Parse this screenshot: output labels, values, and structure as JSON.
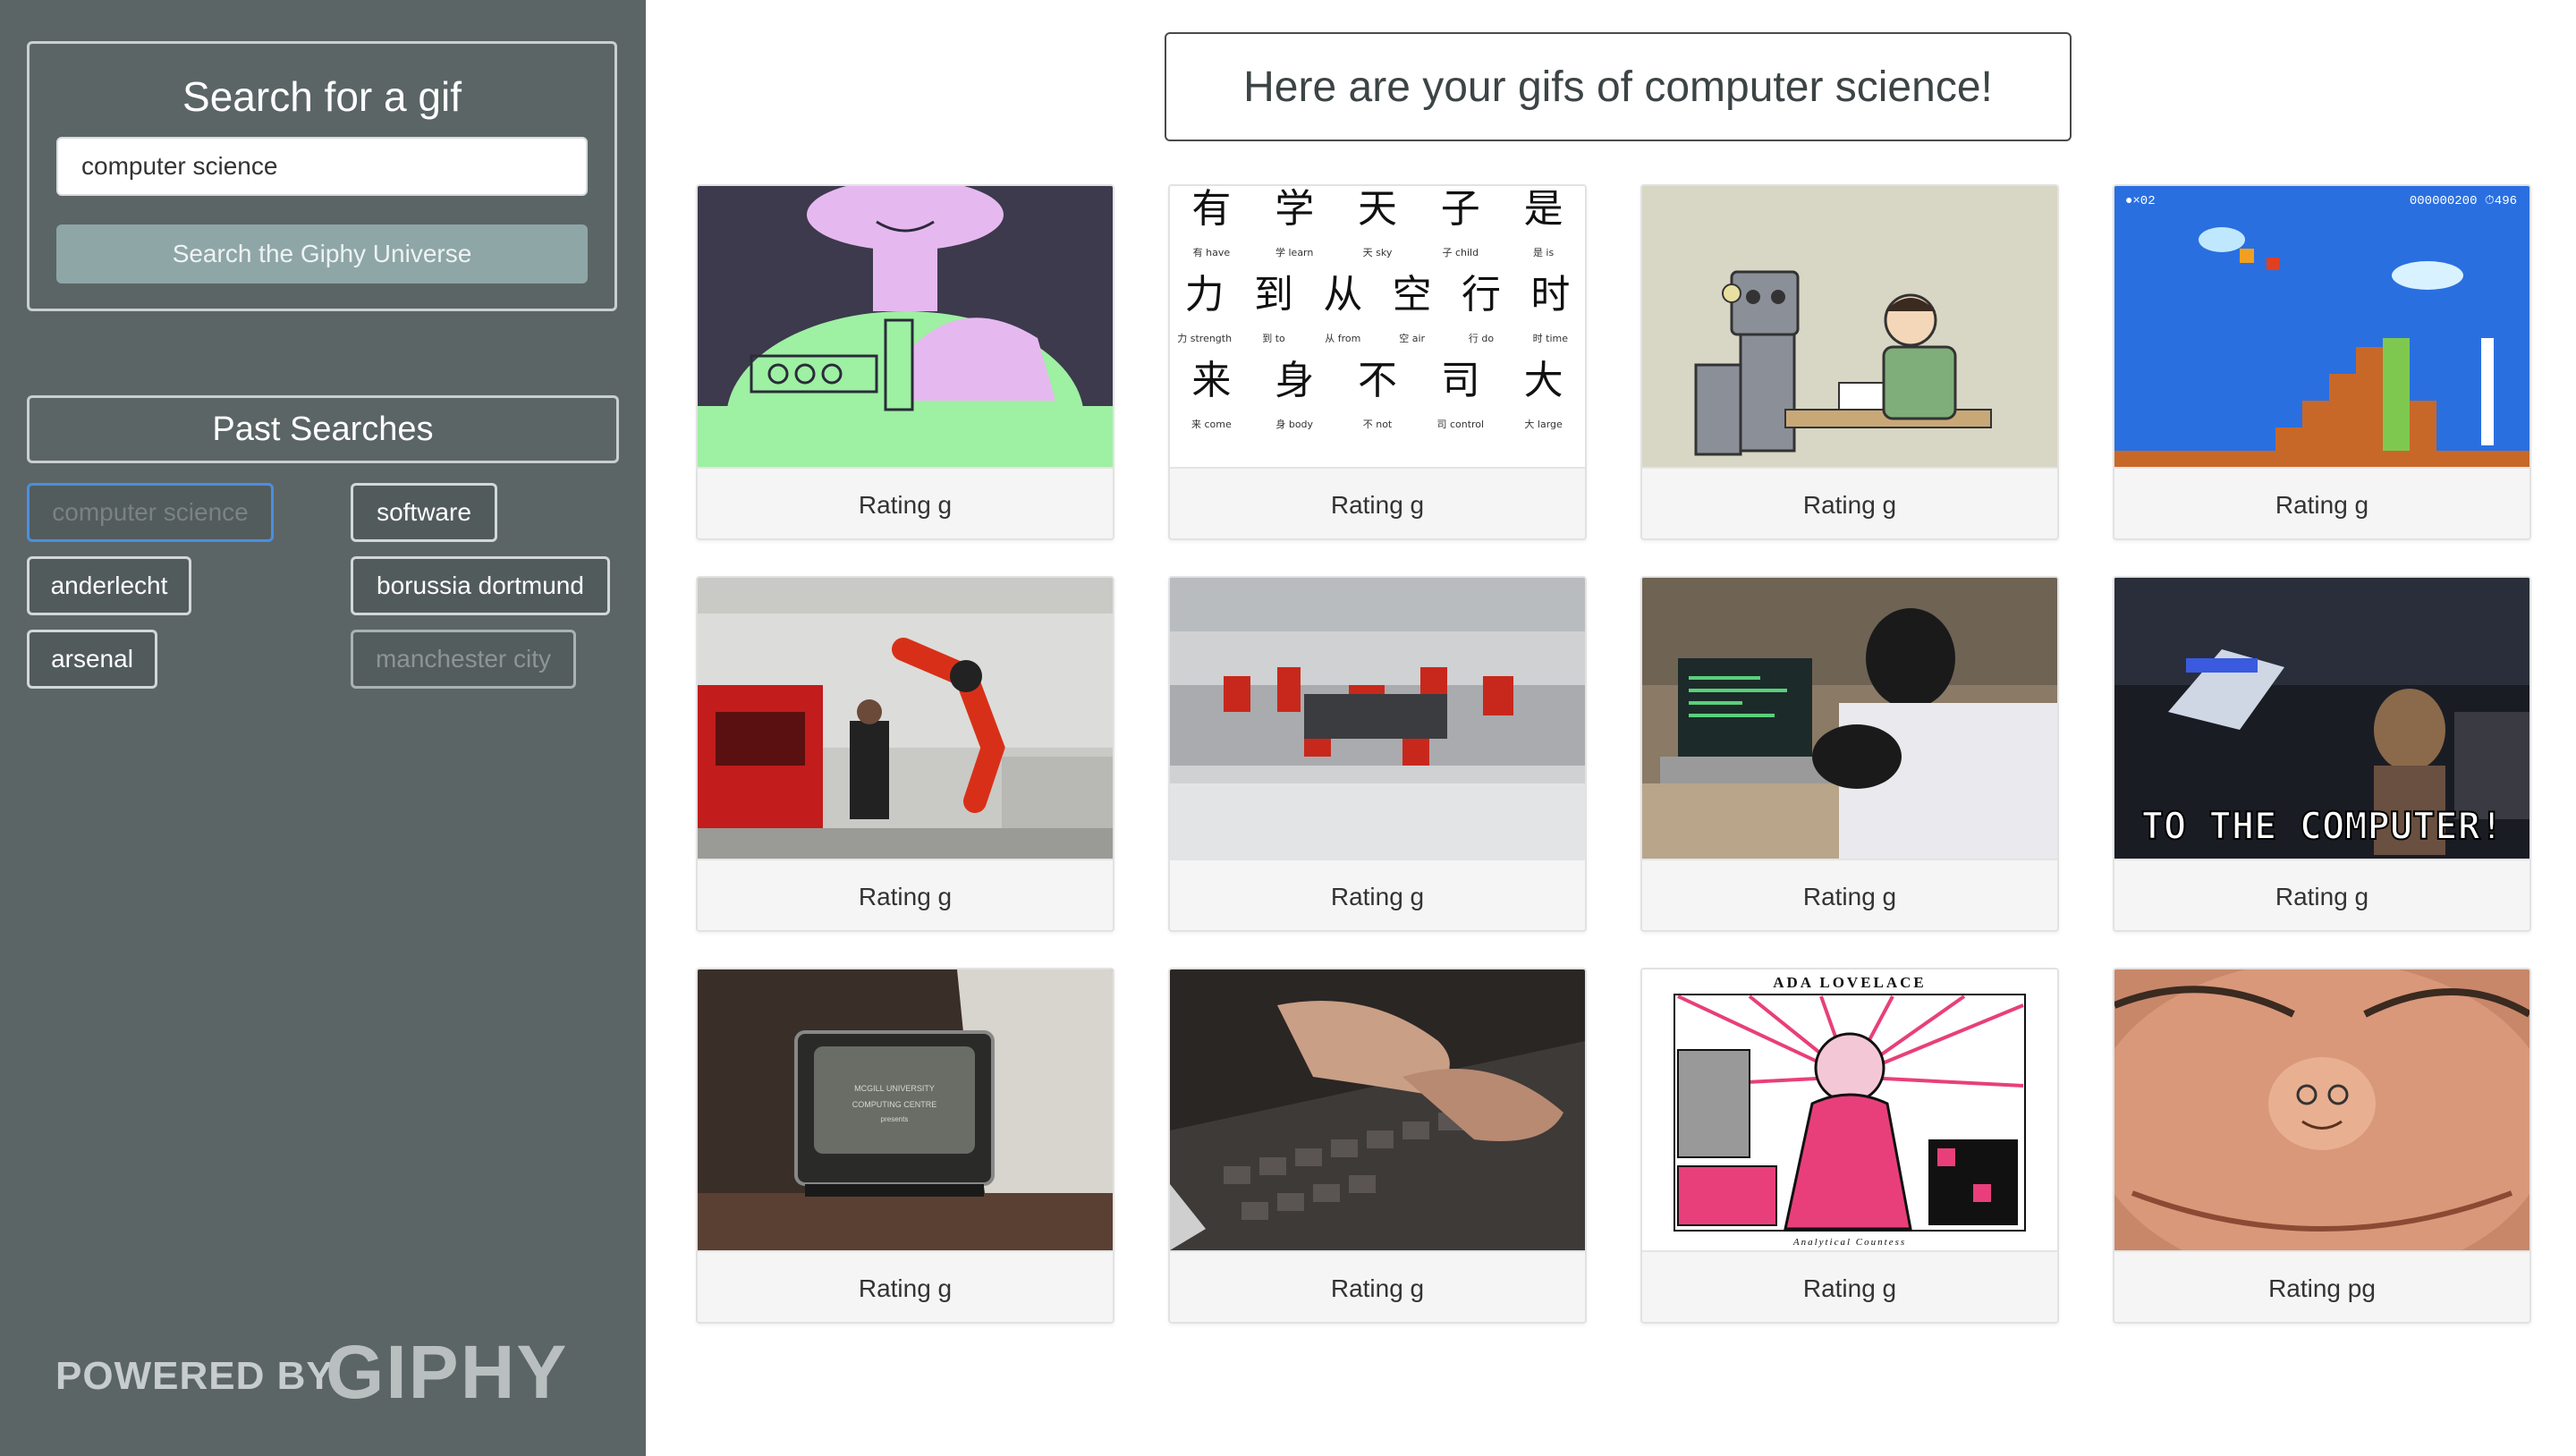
{
  "sidebar": {
    "search_title": "Search for a gif",
    "search_value": "computer science",
    "search_button": "Search the Giphy Universe",
    "past_header": "Past Searches",
    "past_searches": [
      "computer science",
      "software",
      "anderlecht",
      "borussia dortmund",
      "arsenal",
      "manchester city"
    ],
    "powered_by": "POWERED BY",
    "giphy": "GIPHY"
  },
  "main": {
    "title": "Here are your gifs of computer science!",
    "gifs": [
      {
        "rating": "Rating g",
        "icon": "pink-brain-machine-illustration"
      },
      {
        "rating": "Rating g",
        "icon": "chinese-characters-chart"
      },
      {
        "rating": "Rating g",
        "icon": "robot-playing-chess-cartoon"
      },
      {
        "rating": "Rating g",
        "icon": "mario-level-screenshot"
      },
      {
        "rating": "Rating g",
        "icon": "factory-robot-arm-photo"
      },
      {
        "rating": "Rating g",
        "icon": "car-assembly-line-photo"
      },
      {
        "rating": "Rating g",
        "icon": "gorilla-at-laptop-photo"
      },
      {
        "rating": "Rating g",
        "icon": "to-the-computer-scene"
      },
      {
        "rating": "Rating g",
        "icon": "retro-tv-monitor-photo"
      },
      {
        "rating": "Rating g",
        "icon": "typing-on-keyboard-photo"
      },
      {
        "rating": "Rating g",
        "icon": "ada-lovelace-poster"
      },
      {
        "rating": "Rating pg",
        "icon": "face-closeup-photo"
      }
    ],
    "gif_texts": {
      "chinese_chars": [
        "有",
        "学",
        "天",
        "子",
        "是",
        "力",
        "到",
        "从",
        "空",
        "行",
        "时",
        "来",
        "身",
        "不",
        "司",
        "大"
      ],
      "chinese_glosses": [
        "有 have",
        "学 learn",
        "天 sky",
        "子 child",
        "是 is",
        "力 strength",
        "到 to",
        "从 from",
        "空 air",
        "行 do",
        "时 time",
        "来 come",
        "身 body",
        "不 not",
        "司 control",
        "大 large"
      ],
      "mario_lives": "●×02",
      "mario_score": "000000200 ⏱496",
      "computer_caption": "TO THE COMPUTER!",
      "tv_lines": [
        "MCGILL UNIVERSITY",
        "COMPUTING CENTRE",
        "presents"
      ],
      "ada_title": "ADA LOVELACE",
      "ada_subtitle": "Analytical Countess"
    }
  },
  "colors": {
    "sidebar_bg": "#5b6566",
    "search_button_bg": "#8fa6a7",
    "active_chip_border": "#4a8fe0"
  }
}
